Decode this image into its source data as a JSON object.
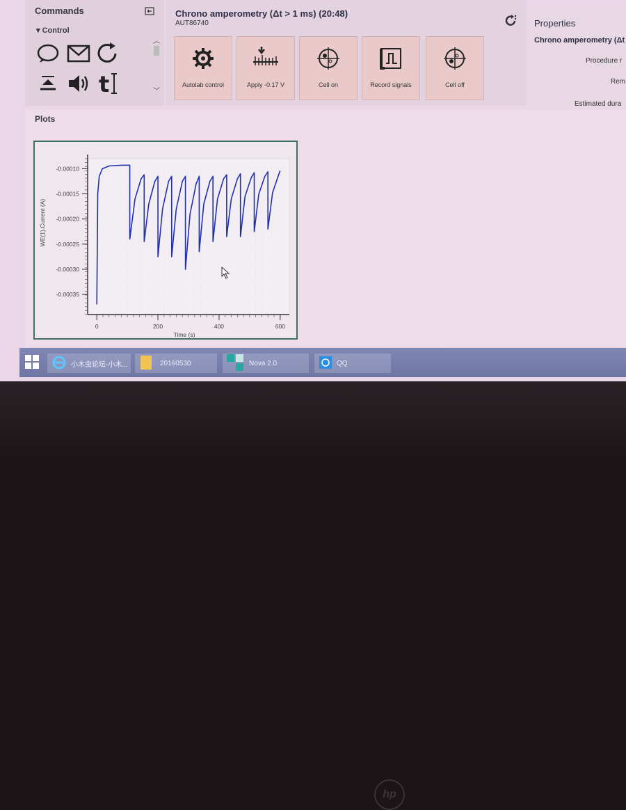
{
  "commands_panel": {
    "title": "Commands",
    "pin_icon": "pin-icon",
    "section": "▾ Control",
    "icons": [
      "wait-icon",
      "message-icon",
      "repeat-icon",
      "import-icon",
      "beep-icon",
      "text-icon"
    ]
  },
  "procedure": {
    "title": "Chrono amperometry (Δt > 1 ms) (20:48)",
    "device": "AUT86740",
    "commands": [
      {
        "label": "Autolab control",
        "icon": "gear-icon"
      },
      {
        "label": "Apply -0.17 V",
        "icon": "apply-potential-icon"
      },
      {
        "label": "Cell on",
        "icon": "cell-on-icon"
      },
      {
        "label": "Record signals",
        "icon": "record-signals-icon"
      },
      {
        "label": "Cell off",
        "icon": "cell-off-icon"
      }
    ]
  },
  "properties": {
    "title": "Properties",
    "procedure_name": "Chrono amperometry (Δt",
    "rows": [
      "Procedure r",
      "Rem",
      "Estimated dura"
    ]
  },
  "plots": {
    "title": "Plots"
  },
  "chart_data": {
    "type": "line",
    "xlabel": "Time (s)",
    "ylabel": "WE(1).Current (A)",
    "xlim": [
      -30,
      630
    ],
    "ylim": [
      -0.00039,
      -8e-05
    ],
    "x_ticks": [
      0,
      200,
      400,
      600
    ],
    "y_ticks": [
      -0.0001,
      -0.00015,
      -0.0002,
      -0.00025,
      -0.0003,
      -0.00035
    ],
    "x_tick_labels": [
      "0",
      "200",
      "400",
      "600"
    ],
    "y_tick_labels": [
      "-0.00010",
      "-0.00015",
      "-0.00020",
      "-0.00025",
      "-0.00030",
      "-0.00035"
    ],
    "series": [
      {
        "color": "#1f2fb0",
        "points": [
          [
            0,
            -0.00037
          ],
          [
            3,
            -0.00015
          ],
          [
            8,
            -0.000115
          ],
          [
            18,
            -0.0001
          ],
          [
            40,
            -9.45e-05
          ],
          [
            80,
            -9.3e-05
          ],
          [
            108,
            -9.3e-05
          ],
          [
            108,
            -0.00024
          ],
          [
            125,
            -0.00016
          ],
          [
            145,
            -0.00012
          ],
          [
            155,
            -0.000112
          ],
          [
            155,
            -0.000245
          ],
          [
            170,
            -0.00017
          ],
          [
            190,
            -0.000125
          ],
          [
            200,
            -0.000115
          ],
          [
            200,
            -0.000275
          ],
          [
            215,
            -0.00018
          ],
          [
            235,
            -0.000125
          ],
          [
            245,
            -0.000115
          ],
          [
            245,
            -0.000275
          ],
          [
            260,
            -0.00018
          ],
          [
            280,
            -0.000125
          ],
          [
            290,
            -0.000115
          ],
          [
            290,
            -0.0003
          ],
          [
            305,
            -0.00019
          ],
          [
            325,
            -0.00013
          ],
          [
            335,
            -0.000115
          ],
          [
            335,
            -0.000265
          ],
          [
            350,
            -0.00017
          ],
          [
            370,
            -0.000125
          ],
          [
            380,
            -0.000115
          ],
          [
            380,
            -0.000245
          ],
          [
            395,
            -0.00016
          ],
          [
            415,
            -0.00012
          ],
          [
            425,
            -0.000112
          ],
          [
            425,
            -0.000235
          ],
          [
            440,
            -0.00016
          ],
          [
            460,
            -0.00012
          ],
          [
            470,
            -0.00011
          ],
          [
            470,
            -0.000235
          ],
          [
            485,
            -0.000155
          ],
          [
            505,
            -0.000118
          ],
          [
            515,
            -0.000108
          ],
          [
            515,
            -0.000225
          ],
          [
            530,
            -0.00015
          ],
          [
            550,
            -0.000115
          ],
          [
            560,
            -0.000106
          ],
          [
            560,
            -0.00022
          ],
          [
            575,
            -0.000148
          ],
          [
            595,
            -0.000112
          ],
          [
            600,
            -0.000104
          ]
        ]
      }
    ]
  },
  "taskbar": {
    "items": [
      {
        "label": "小木虫论坛-小木...",
        "icon": "ie-icon"
      },
      {
        "label": "20160530",
        "icon": "folder-icon"
      },
      {
        "label": "Nova 2.0",
        "icon": "nova-icon"
      },
      {
        "label": "QQ",
        "icon": "qq-icon"
      }
    ]
  },
  "bezel": {
    "logo": "hp"
  }
}
